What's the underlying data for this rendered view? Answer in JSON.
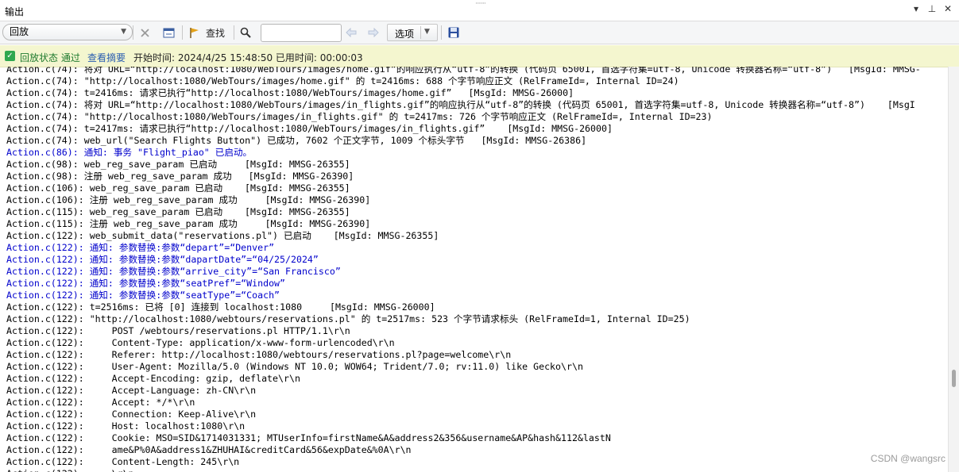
{
  "window": {
    "title": "输出",
    "controls": [
      "▾",
      "⊥",
      "✕"
    ]
  },
  "toolbar": {
    "mode_value": "回放",
    "find_label": "查找",
    "find_value": "",
    "options_label": "选项"
  },
  "status": {
    "state": "回放状态 通过",
    "summary_link": "查看摘要",
    "time_info": "开始时间: 2024/4/25 15:48:50 已用时间: 00:00:03"
  },
  "log": [
    {
      "kind": "normal",
      "text": "Action.c(74): 将对 URL=“http://localhost:1080/WebTours/images/home.gif”的响应执行从“utf-8”的转换 (代码页 65001, 首选字符集=utf-8, Unicode 转换器名称=“utf-8”)   [MsgId: MMSG-"
    },
    {
      "kind": "normal",
      "text": "Action.c(74): \"http://localhost:1080/WebTours/images/home.gif\" 的 t=2416ms: 688 个字节响应正文 (RelFrameId=, Internal ID=24)"
    },
    {
      "kind": "normal",
      "text": "Action.c(74): t=2416ms: 请求已执行“http://localhost:1080/WebTours/images/home.gif”   [MsgId: MMSG-26000]"
    },
    {
      "kind": "normal",
      "text": "Action.c(74): 将对 URL=“http://localhost:1080/WebTours/images/in_flights.gif”的响应执行从“utf-8”的转换 (代码页 65001, 首选字符集=utf-8, Unicode 转换器名称=“utf-8”)    [MsgI"
    },
    {
      "kind": "normal",
      "text": "Action.c(74): \"http://localhost:1080/WebTours/images/in_flights.gif\" 的 t=2417ms: 726 个字节响应正文 (RelFrameId=, Internal ID=23)"
    },
    {
      "kind": "normal",
      "text": "Action.c(74): t=2417ms: 请求已执行“http://localhost:1080/WebTours/images/in_flights.gif”    [MsgId: MMSG-26000]"
    },
    {
      "kind": "normal",
      "text": "Action.c(74): web_url(\"Search Flights Button\") 已成功, 7602 个正文字节, 1009 个标头字节   [MsgId: MMSG-26386]"
    },
    {
      "kind": "notice",
      "text": "Action.c(86): 通知: 事务 \"Flight_piao\" 已启动。"
    },
    {
      "kind": "normal",
      "text": "Action.c(98): web_reg_save_param 已启动     [MsgId: MMSG-26355]"
    },
    {
      "kind": "normal",
      "text": "Action.c(98): 注册 web_reg_save_param 成功   [MsgId: MMSG-26390]"
    },
    {
      "kind": "normal",
      "text": "Action.c(106): web_reg_save_param 已启动    [MsgId: MMSG-26355]"
    },
    {
      "kind": "normal",
      "text": "Action.c(106): 注册 web_reg_save_param 成功     [MsgId: MMSG-26390]"
    },
    {
      "kind": "normal",
      "text": "Action.c(115): web_reg_save_param 已启动    [MsgId: MMSG-26355]"
    },
    {
      "kind": "normal",
      "text": "Action.c(115): 注册 web_reg_save_param 成功     [MsgId: MMSG-26390]"
    },
    {
      "kind": "normal",
      "text": "Action.c(122): web_submit_data(\"reservations.pl\") 已启动    [MsgId: MMSG-26355]"
    },
    {
      "kind": "notice",
      "text": "Action.c(122): 通知: 参数替换:参数“depart”=“Denver”"
    },
    {
      "kind": "notice",
      "text": "Action.c(122): 通知: 参数替换:参数“dapartDate”=“04/25/2024”"
    },
    {
      "kind": "notice",
      "text": "Action.c(122): 通知: 参数替换:参数“arrive_city”=“San Francisco”"
    },
    {
      "kind": "notice",
      "text": "Action.c(122): 通知: 参数替换:参数“seatPref”=“Window”"
    },
    {
      "kind": "notice",
      "text": "Action.c(122): 通知: 参数替换:参数“seatType”=“Coach”"
    },
    {
      "kind": "normal",
      "text": "Action.c(122): t=2516ms: 已将 [0] 连接到 localhost:1080     [MsgId: MMSG-26000]"
    },
    {
      "kind": "normal",
      "text": "Action.c(122): \"http://localhost:1080/webtours/reservations.pl\" 的 t=2517ms: 523 个字节请求标头 (RelFrameId=1, Internal ID=25)"
    },
    {
      "kind": "normal",
      "text": "Action.c(122):     POST /webtours/reservations.pl HTTP/1.1\\r\\n"
    },
    {
      "kind": "normal",
      "text": "Action.c(122):     Content-Type: application/x-www-form-urlencoded\\r\\n"
    },
    {
      "kind": "normal",
      "text": "Action.c(122):     Referer: http://localhost:1080/webtours/reservations.pl?page=welcome\\r\\n"
    },
    {
      "kind": "normal",
      "text": "Action.c(122):     User-Agent: Mozilla/5.0 (Windows NT 10.0; WOW64; Trident/7.0; rv:11.0) like Gecko\\r\\n"
    },
    {
      "kind": "normal",
      "text": "Action.c(122):     Accept-Encoding: gzip, deflate\\r\\n"
    },
    {
      "kind": "normal",
      "text": "Action.c(122):     Accept-Language: zh-CN\\r\\n"
    },
    {
      "kind": "normal",
      "text": "Action.c(122):     Accept: */*\\r\\n"
    },
    {
      "kind": "normal",
      "text": "Action.c(122):     Connection: Keep-Alive\\r\\n"
    },
    {
      "kind": "normal",
      "text": "Action.c(122):     Host: localhost:1080\\r\\n"
    },
    {
      "kind": "normal",
      "text": "Action.c(122):     Cookie: MSO=SID&1714031331; MTUserInfo=firstName&A&address2&356&username&AP&hash&112&lastN"
    },
    {
      "kind": "normal",
      "text": "Action.c(122):     ame&P%0A&address1&ZHUHAI&creditCard&56&expDate&%0A\\r\\n"
    },
    {
      "kind": "normal",
      "text": "Action.c(122):     Content-Length: 245\\r\\n"
    },
    {
      "kind": "normal",
      "text": "Action.c(122):     \\r\\n"
    }
  ],
  "watermark": "CSDN @wangsrc"
}
